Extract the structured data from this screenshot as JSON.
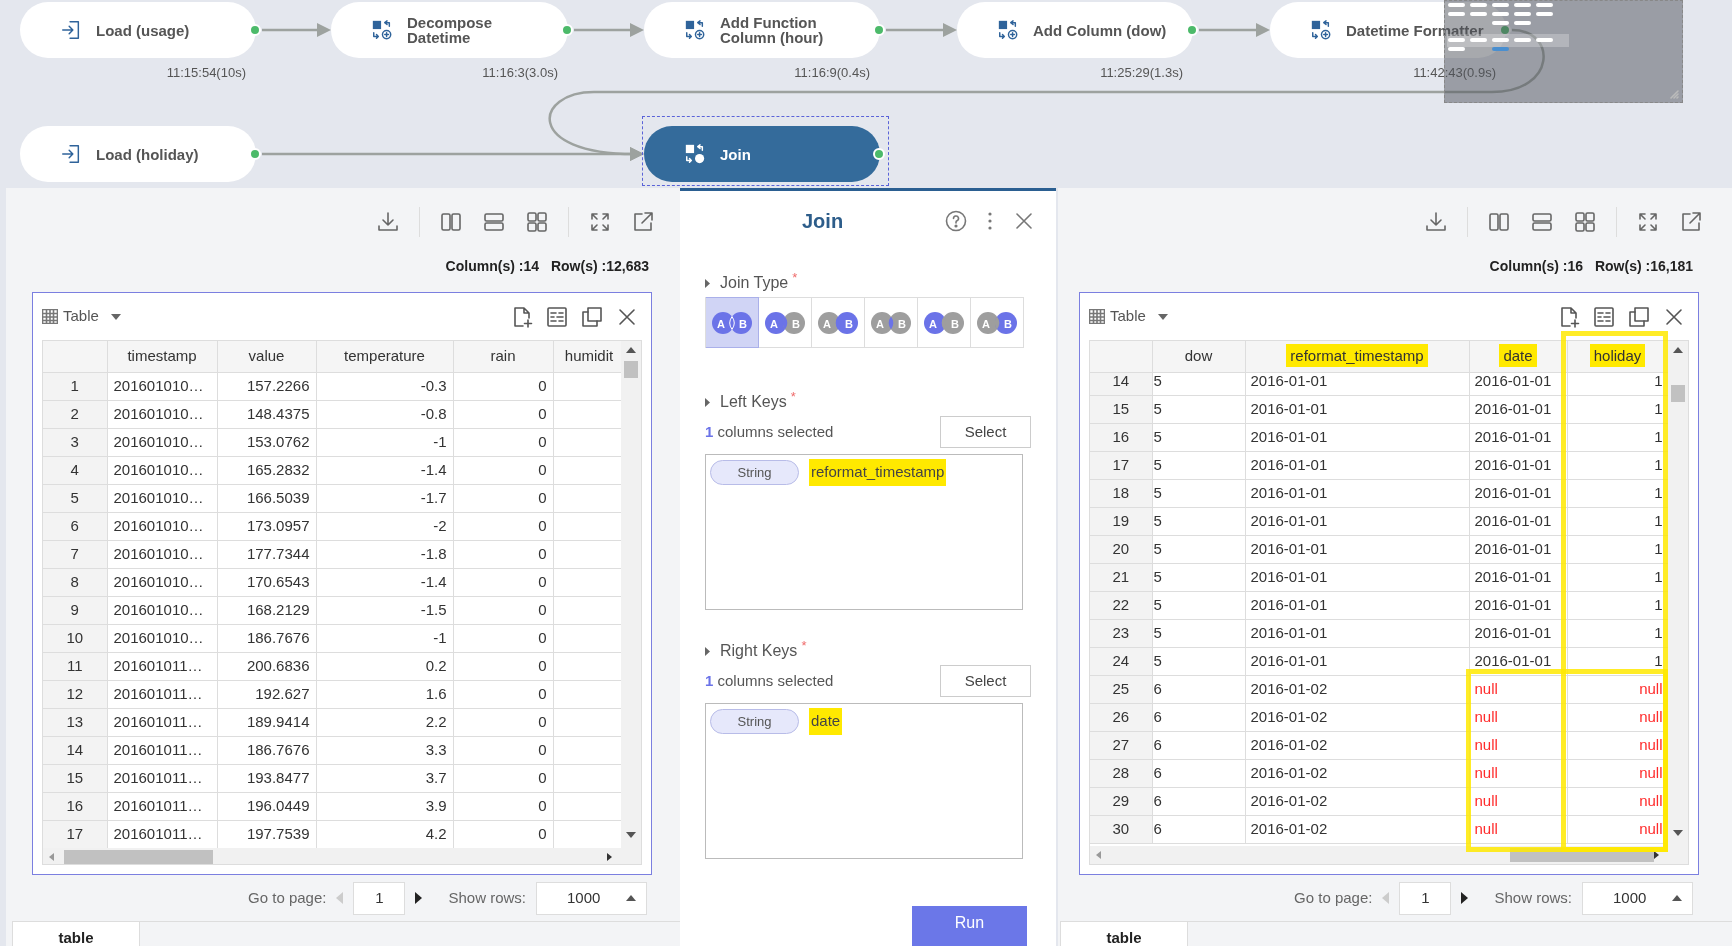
{
  "canvas": {
    "nodes": [
      {
        "label": "Load (usage)",
        "kind": "load",
        "time": "11:15:54(10s)",
        "selected": false
      },
      {
        "label": "Decompose Datetime",
        "kind": "transform",
        "time": "11:16:3(3.0s)",
        "selected": false
      },
      {
        "label": "Add Function Column (hour)",
        "kind": "transform",
        "time": "11:16:9(0.4s)",
        "selected": false
      },
      {
        "label": "Add Column (dow)",
        "kind": "transform",
        "time": "11:25:29(1.3s)",
        "selected": false
      },
      {
        "label": "Datetime Formatter",
        "kind": "transform",
        "time": "11:42:43(0.9s)",
        "selected": false
      },
      {
        "label": "Load (holiday)",
        "kind": "load",
        "selected": false
      },
      {
        "label": "Join",
        "kind": "join",
        "selected": true
      }
    ]
  },
  "left_panel": {
    "columns_count": "Column(s) :14",
    "rows_count": "Row(s) :12,683",
    "view": "Table",
    "table": {
      "columns": [
        "timestamp",
        "value",
        "temperature",
        "rain",
        "humidit"
      ],
      "rows": [
        {
          "index": "1",
          "cells": [
            "201601010…",
            "157.2266",
            "-0.3",
            "0"
          ]
        },
        {
          "index": "2",
          "cells": [
            "201601010…",
            "148.4375",
            "-0.8",
            "0"
          ]
        },
        {
          "index": "3",
          "cells": [
            "201601010…",
            "153.0762",
            "-1",
            "0"
          ]
        },
        {
          "index": "4",
          "cells": [
            "201601010…",
            "165.2832",
            "-1.4",
            "0"
          ]
        },
        {
          "index": "5",
          "cells": [
            "201601010…",
            "166.5039",
            "-1.7",
            "0"
          ]
        },
        {
          "index": "6",
          "cells": [
            "201601010…",
            "173.0957",
            "-2",
            "0"
          ]
        },
        {
          "index": "7",
          "cells": [
            "201601010…",
            "177.7344",
            "-1.8",
            "0"
          ]
        },
        {
          "index": "8",
          "cells": [
            "201601010…",
            "170.6543",
            "-1.4",
            "0"
          ]
        },
        {
          "index": "9",
          "cells": [
            "201601010…",
            "168.2129",
            "-1.5",
            "0"
          ]
        },
        {
          "index": "10",
          "cells": [
            "201601010…",
            "186.7676",
            "-1",
            "0"
          ]
        },
        {
          "index": "11",
          "cells": [
            "201601011…",
            "200.6836",
            "0.2",
            "0"
          ]
        },
        {
          "index": "12",
          "cells": [
            "201601011…",
            "192.627",
            "1.6",
            "0"
          ]
        },
        {
          "index": "13",
          "cells": [
            "201601011…",
            "189.9414",
            "2.2",
            "0"
          ]
        },
        {
          "index": "14",
          "cells": [
            "201601011…",
            "186.7676",
            "3.3",
            "0"
          ]
        },
        {
          "index": "15",
          "cells": [
            "201601011…",
            "193.8477",
            "3.7",
            "0"
          ]
        },
        {
          "index": "16",
          "cells": [
            "201601011…",
            "196.0449",
            "3.9",
            "0"
          ]
        },
        {
          "index": "17",
          "cells": [
            "201601011…",
            "197.7539",
            "4.2",
            "0"
          ]
        }
      ]
    },
    "pager": {
      "page_label": "Go to page:",
      "page": "1",
      "rows_label": "Show rows:",
      "rows": "1000"
    },
    "tabs": [
      {
        "label": "table",
        "selected": true
      }
    ]
  },
  "join_panel": {
    "title": "Join",
    "join_type": {
      "label": "Join Type",
      "required_mark": "*",
      "options": [
        {
          "kind": "full",
          "a": "A",
          "b": "B",
          "selected": true
        },
        {
          "kind": "left",
          "a": "A",
          "b": "B",
          "selected": false
        },
        {
          "kind": "right",
          "a": "A",
          "b": "B",
          "selected": false
        },
        {
          "kind": "inner",
          "a": "A",
          "b": "B",
          "selected": false
        },
        {
          "kind": "left_only",
          "a": "A",
          "b": "B",
          "selected": false
        },
        {
          "kind": "right_only",
          "a": "A",
          "b": "B",
          "selected": false
        }
      ]
    },
    "left_keys": {
      "label": "Left Keys",
      "required_mark": "*",
      "count": "1",
      "count_text": "columns selected",
      "button": "Select",
      "keys": [
        {
          "type": "String",
          "name": "reformat_timestamp",
          "highlighted": true
        }
      ]
    },
    "right_keys": {
      "label": "Right Keys",
      "required_mark": "*",
      "count": "1",
      "count_text": "columns selected",
      "button": "Select",
      "keys": [
        {
          "type": "String",
          "name": "date",
          "highlighted": true
        }
      ]
    },
    "run_button": "Run"
  },
  "right_panel": {
    "columns_count": "Column(s) :16",
    "rows_count": "Row(s) :16,181",
    "view": "Table",
    "table": {
      "columns": [
        {
          "label": "dow",
          "highlighted": false
        },
        {
          "label": "reformat_timestamp",
          "highlighted": true
        },
        {
          "label": "date",
          "highlighted": true
        },
        {
          "label": "holiday",
          "highlighted": true
        }
      ],
      "rows": [
        {
          "index": "14",
          "cells": [
            "5",
            "2016-01-01",
            "2016-01-01",
            "1"
          ],
          "has_nulls": false
        },
        {
          "index": "15",
          "cells": [
            "5",
            "2016-01-01",
            "2016-01-01",
            "1"
          ],
          "has_nulls": false
        },
        {
          "index": "16",
          "cells": [
            "5",
            "2016-01-01",
            "2016-01-01",
            "1"
          ],
          "has_nulls": false
        },
        {
          "index": "17",
          "cells": [
            "5",
            "2016-01-01",
            "2016-01-01",
            "1"
          ],
          "has_nulls": false
        },
        {
          "index": "18",
          "cells": [
            "5",
            "2016-01-01",
            "2016-01-01",
            "1"
          ],
          "has_nulls": false
        },
        {
          "index": "19",
          "cells": [
            "5",
            "2016-01-01",
            "2016-01-01",
            "1"
          ],
          "has_nulls": false
        },
        {
          "index": "20",
          "cells": [
            "5",
            "2016-01-01",
            "2016-01-01",
            "1"
          ],
          "has_nulls": false
        },
        {
          "index": "21",
          "cells": [
            "5",
            "2016-01-01",
            "2016-01-01",
            "1"
          ],
          "has_nulls": false
        },
        {
          "index": "22",
          "cells": [
            "5",
            "2016-01-01",
            "2016-01-01",
            "1"
          ],
          "has_nulls": false
        },
        {
          "index": "23",
          "cells": [
            "5",
            "2016-01-01",
            "2016-01-01",
            "1"
          ],
          "has_nulls": false
        },
        {
          "index": "24",
          "cells": [
            "5",
            "2016-01-01",
            "2016-01-01",
            "1"
          ],
          "has_nulls": false
        },
        {
          "index": "25",
          "cells": [
            "6",
            "2016-01-02",
            "null",
            "null"
          ],
          "has_nulls": true
        },
        {
          "index": "26",
          "cells": [
            "6",
            "2016-01-02",
            "null",
            "null"
          ],
          "has_nulls": true
        },
        {
          "index": "27",
          "cells": [
            "6",
            "2016-01-02",
            "null",
            "null"
          ],
          "has_nulls": true
        },
        {
          "index": "28",
          "cells": [
            "6",
            "2016-01-02",
            "null",
            "null"
          ],
          "has_nulls": true
        },
        {
          "index": "29",
          "cells": [
            "6",
            "2016-01-02",
            "null",
            "null"
          ],
          "has_nulls": true
        },
        {
          "index": "30",
          "cells": [
            "6",
            "2016-01-02",
            "null",
            "null"
          ],
          "has_nulls": true
        }
      ]
    },
    "pager": {
      "page_label": "Go to page:",
      "page": "1",
      "rows_label": "Show rows:",
      "rows": "1000"
    },
    "tabs": [
      {
        "label": "table",
        "selected": true
      }
    ]
  }
}
